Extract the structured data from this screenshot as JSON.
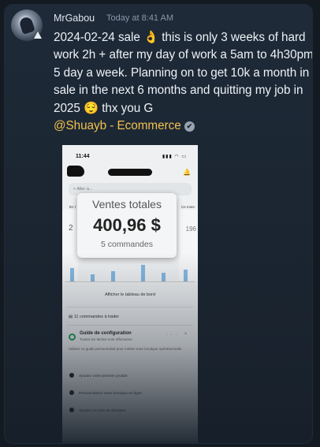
{
  "message": {
    "username": "MrGabou",
    "timestamp": "Today at 8:41 AM",
    "text_before": "2024-02-24 sale ",
    "emoji_ok": "👌",
    "text_middle": " this is only 3 weeks of hard work 2h + after my day of work a 5am to 4h30pm 5 day a week. Planning on to get 10k a month in sale in the next 6 months and quitting my job in 2025 ",
    "emoji_relieved": "😌",
    "text_after": " thx you G",
    "mention": "@Shuayb - Ecommerce",
    "verified_icon": "✔"
  },
  "screenshot": {
    "status_time": "11:44",
    "status_icons": "▮▮▮ ◠ ▭",
    "bell_icon": "🔔",
    "search_placeholder": "Aller à...",
    "label_left": "En l",
    "label_right": "Ce mois-",
    "num_left": "2",
    "num_right": "196",
    "tooltip_label": "Ventes totales",
    "tooltip_value": "400,96 $",
    "tooltip_orders": "5 commandes",
    "dashboard_link": "Afficher le tableau de bord",
    "orders_to_process": "11 commandes à traiter",
    "setup_title": "Guide de configuration",
    "setup_subtitle": "Toutes les tâches sont effectuées",
    "setup_description": "Utilisez ce guide personnalisé pour mettre votre boutique opérationnelle.",
    "setup_controls": "··· ^",
    "tasks": [
      "Ajoutez votre premier produit",
      "Personnalisez votre boutique en ligne",
      "Ajoutez un nom de domaine"
    ]
  },
  "colors": {
    "mention": "#f2c14e",
    "accent_green": "#1e9e5a",
    "bar_blue": "#3a8fd6"
  }
}
